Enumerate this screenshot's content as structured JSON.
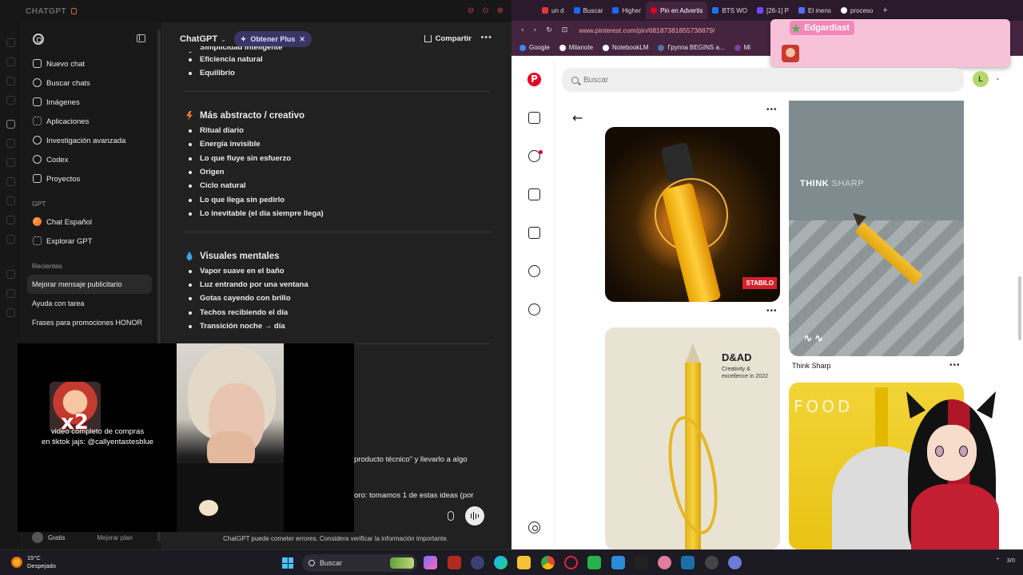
{
  "left_window": {
    "title": "CHATGPT",
    "sidebar": {
      "items": [
        {
          "label": "Nuevo chat",
          "icon": "edit-icon"
        },
        {
          "label": "Buscar chats",
          "icon": "search-icon"
        },
        {
          "label": "Imágenes",
          "icon": "image-icon"
        },
        {
          "label": "Aplicaciones",
          "icon": "apps-icon"
        },
        {
          "label": "Investigación avanzada",
          "icon": "research-icon"
        },
        {
          "label": "Codex",
          "icon": "codex-icon"
        },
        {
          "label": "Proyectos",
          "icon": "folder-icon"
        }
      ],
      "gpt_label": "GPT",
      "gpts": [
        {
          "label": "Chat Español",
          "icon": "chat-espanol-icon"
        },
        {
          "label": "Explorar GPT",
          "icon": "grid-icon"
        }
      ],
      "recents_label": "Recientes",
      "recents": [
        "Mejorar mensaje publicitario",
        "Ayuda con tarea",
        "Frases para promociones HONOR"
      ],
      "plan": "Gratis",
      "upgrade": "Mejorar plan"
    },
    "header": {
      "model": "ChatGPT",
      "plus_label": "Obtener Plus",
      "share_label": "Compartir"
    },
    "message": {
      "top_items": [
        "Simplicidad inteligente",
        "Eficiencia natural",
        "Equilibrio"
      ],
      "section_abstract": {
        "title": "Más abstracto / creativo",
        "items": [
          "Ritual diario",
          "Energía invisible",
          "Lo que fluye sin esfuerzo",
          "Origen",
          "Ciclo natural",
          "Lo que llega sin pedirlo",
          "Lo inevitable (el día siempre llega)"
        ]
      },
      "section_visual": {
        "title": "Visuales mentales",
        "items": [
          "Vapor suave en el baño",
          "Luz entrando por una ventana",
          "Gotas cayendo con brillo",
          "Techos recibiendo el día",
          "Transición noche → día"
        ]
      },
      "fragment_1": "producto técnico” y llevarlo a algo",
      "fragment_2": "oro: tomamos 1 de estas ideas (por"
    },
    "disclaimer": "ChatGPT puede cometer errores. Considera verificar la información importante."
  },
  "overlay": {
    "badge": "x2",
    "caption_line1": "video completo de compras",
    "caption_line2": "en tiktok jajs: @callyentastesblue"
  },
  "browser": {
    "tabs": [
      {
        "label": "un d",
        "color": "#e53935"
      },
      {
        "label": "Buscar",
        "color": "#1769ff"
      },
      {
        "label": "Higher",
        "color": "#1769ff"
      },
      {
        "label": "Pin en Advertis",
        "color": "#e60023",
        "active": true
      },
      {
        "label": "BTS WO",
        "color": "#1877f2"
      },
      {
        "label": "[26-1] P",
        "color": "#6a4cff"
      },
      {
        "label": "El mens",
        "color": "#4c6fff"
      },
      {
        "label": "proceso",
        "color": "#ffffff"
      }
    ],
    "url": "www.pinterest.com/pin/681873818557388​79/",
    "bookmarks": [
      {
        "label": "Google",
        "color": "#4285f4"
      },
      {
        "label": "Milanote",
        "color": "#ffffff"
      },
      {
        "label": "NotebookLM",
        "color": "#ffffff"
      },
      {
        "label": "Группа BEGINS a...",
        "color": "#4a76a8"
      },
      {
        "label": "Mi",
        "color": "#7b3fa0"
      }
    ],
    "alert_name": "Edgardiast",
    "search_placeholder": "Buscar",
    "profile_initial": "L",
    "pins": {
      "stabilo_badge": "STABILO",
      "think_sharp_heading": "THINK",
      "think_sharp_heading_2": "SHARP",
      "think_sharp_title": "Think Sharp",
      "dad_title": "D&AD",
      "dad_sub": "Creativity & excellence in 2022",
      "food_title": "FOOD"
    }
  },
  "taskbar": {
    "temp": "15°C",
    "weather": "Despejado",
    "search": "Buscar",
    "tray_time": "3/0"
  }
}
